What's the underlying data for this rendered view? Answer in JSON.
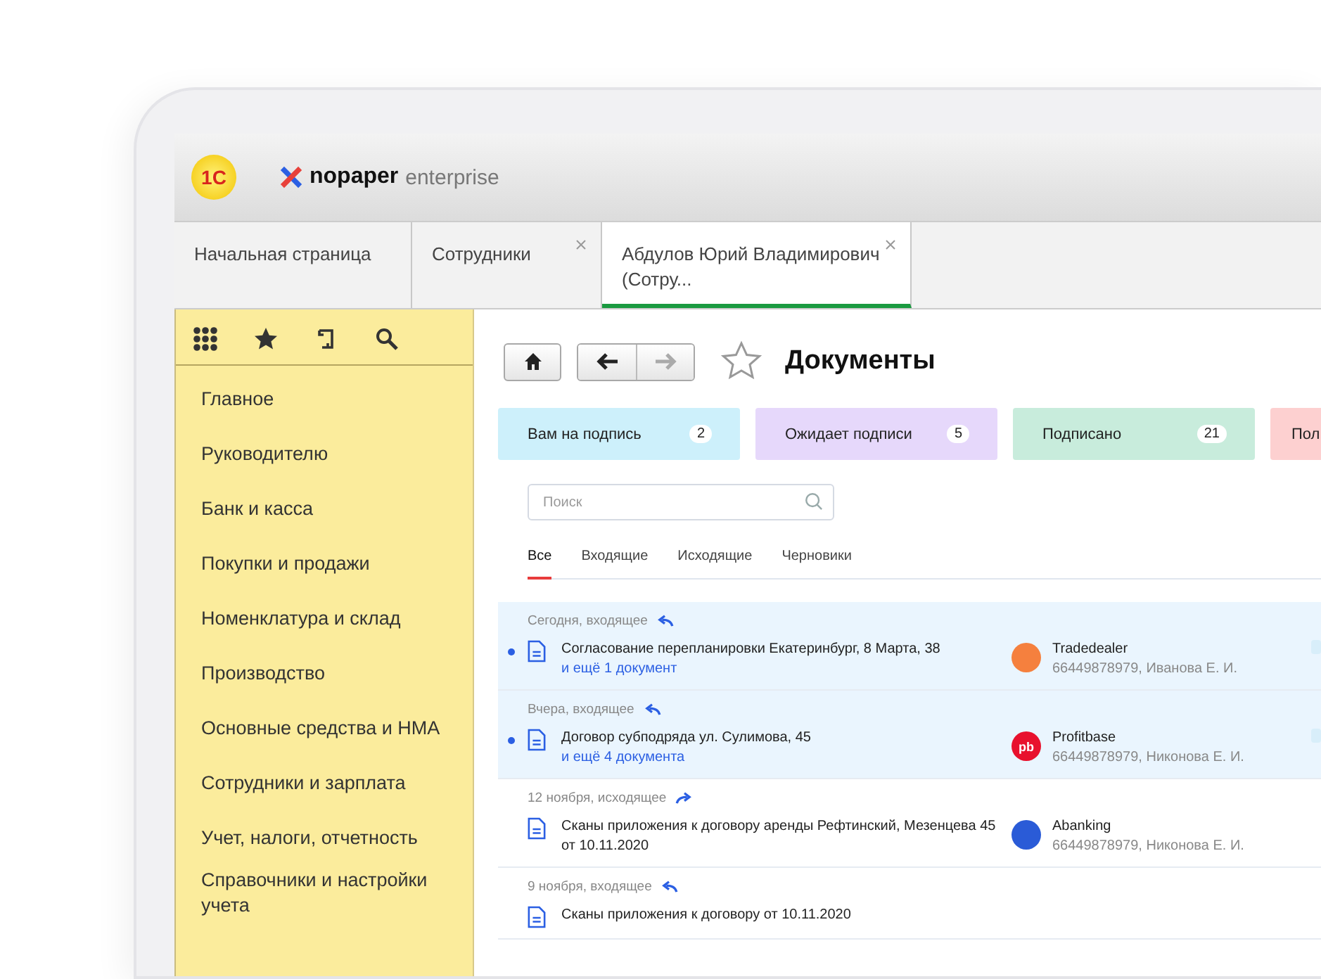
{
  "header": {
    "logo_1c": "1С",
    "brand_name": "nopaper",
    "brand_suffix": "enterprise"
  },
  "tabs": [
    {
      "label": "Начальная страница",
      "selected": false,
      "closable": false
    },
    {
      "label": "Сотрудники",
      "selected": false,
      "closable": true
    },
    {
      "label": "Абдулов Юрий Владимирович (Сотру...",
      "selected": true,
      "closable": true
    }
  ],
  "sidebar": {
    "items": [
      "Главное",
      "Руководителю",
      "Банк и касса",
      "Покупки и продажи",
      "Номенклатура и склад",
      "Производство",
      "Основные средства и НМА",
      "Сотрудники и зарплата",
      "Учет, налоги, отчетность",
      "Справочники и настройки учета"
    ]
  },
  "page": {
    "title": "Документы",
    "favorite": false
  },
  "status_cards": [
    {
      "label": "Вам на подпись",
      "count": "2",
      "color": "#cdf0fb"
    },
    {
      "label": "Ожидает подписи",
      "count": "5",
      "color": "#e6d8fb"
    },
    {
      "label": "Подписано",
      "count": "21",
      "color": "#c8ecdc"
    },
    {
      "label": "Пол",
      "color": "#fdd0d0"
    }
  ],
  "search": {
    "placeholder": "Поиск"
  },
  "filter_tabs": [
    {
      "label": "Все",
      "selected": true
    },
    {
      "label": "Входящие",
      "selected": false
    },
    {
      "label": "Исходящие",
      "selected": false
    },
    {
      "label": "Черновики",
      "selected": false
    }
  ],
  "documents": [
    {
      "date": "Сегодня, входящее",
      "kind": "incoming",
      "unread": true,
      "title": "Согласование перепланировки Екатеринбург, 8 Марта, 38",
      "more": "и ещё 1 документ",
      "counterparty": {
        "name": "Tradedealer",
        "details": "66449878979, Иванова Е. И.",
        "color": "#f5803e"
      }
    },
    {
      "date": "Вчера, входящее",
      "kind": "incoming",
      "unread": true,
      "title": "Договор субподряда ул. Сулимова, 45",
      "more": "и ещё 4 документа",
      "counterparty": {
        "name": "Profitbase",
        "details": "66449878979, Никонова Е. И.",
        "color": "#e8112d",
        "initials": "pb"
      }
    },
    {
      "date": "12 ноября, исходящее",
      "kind": "outgoing",
      "unread": false,
      "title": "Сканы приложения к договору аренды Рефтинский, Мезенцева 45 от 10.11.2020",
      "counterparty": {
        "name": "Abanking",
        "details": "66449878979, Никонова Е. И.",
        "color": "#2a5bd7"
      }
    },
    {
      "date": "9 ноября, входящее",
      "kind": "incoming",
      "unread": false,
      "title": "Сканы приложения к договору от 10.11.2020"
    }
  ]
}
